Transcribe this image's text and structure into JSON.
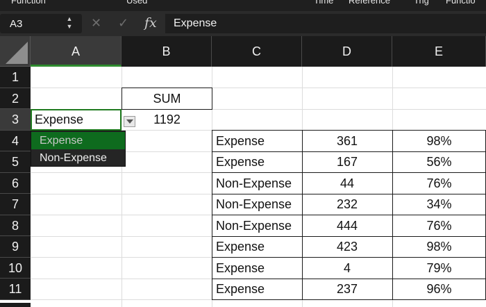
{
  "ribbon": [
    "Function",
    "Used",
    "Time",
    "Reference",
    "Trig",
    "Functio"
  ],
  "formula_bar": {
    "name_box": "A3",
    "stepper_up": "▲",
    "stepper_down": "▼",
    "cancel_glyph": "✕",
    "confirm_glyph": "✓",
    "fx_label": "fx",
    "value": "Expense"
  },
  "columns": [
    "A",
    "B",
    "C",
    "D",
    "E"
  ],
  "rows": [
    "1",
    "2",
    "3",
    "4",
    "5",
    "6",
    "7",
    "8",
    "9",
    "10",
    "11"
  ],
  "sum_header": "SUM",
  "sum_value": "1192",
  "active_cell_value": "Expense",
  "dropdown": {
    "options": [
      "Expense",
      "Non-Expense"
    ],
    "highlighted": 0
  },
  "table": [
    [
      "Expense",
      "361",
      "98%"
    ],
    [
      "Expense",
      "167",
      "56%"
    ],
    [
      "Non-Expense",
      "44",
      "76%"
    ],
    [
      "Non-Expense",
      "232",
      "34%"
    ],
    [
      "Non-Expense",
      "444",
      "76%"
    ],
    [
      "Expense",
      "423",
      "98%"
    ],
    [
      "Expense",
      "4",
      "79%"
    ],
    [
      "Expense",
      "237",
      "96%"
    ]
  ],
  "colors": {
    "selection_green": "#1f7a1f",
    "dropdown_highlight": "#0e6b1e",
    "header_bg": "#1b1b1b"
  }
}
